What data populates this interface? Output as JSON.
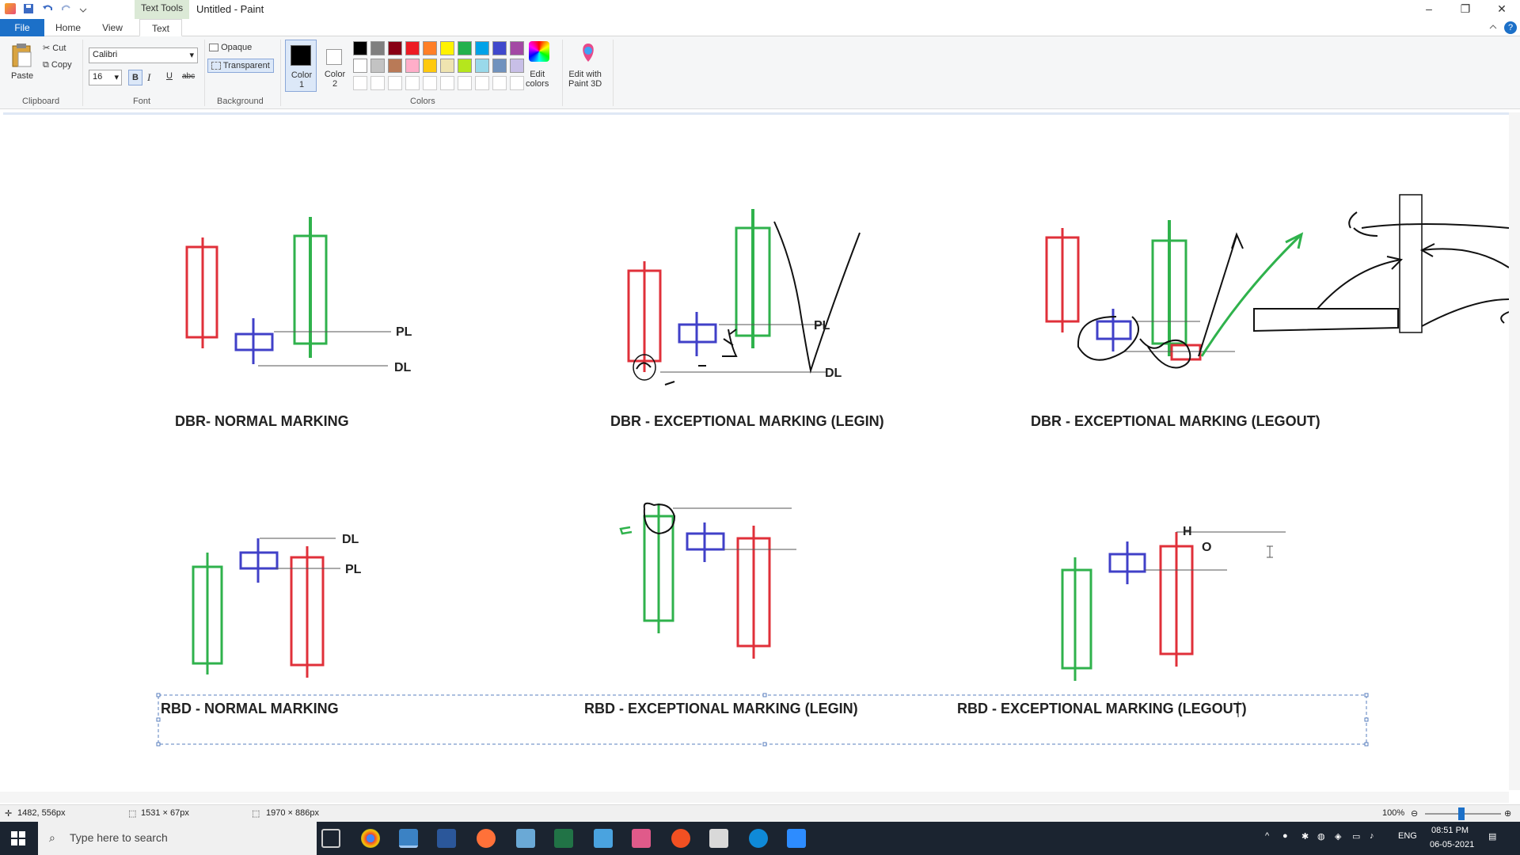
{
  "window": {
    "contextual_tab": "Text Tools",
    "title": "Untitled - Paint",
    "minimize": "–",
    "restore": "❐",
    "close": "✕"
  },
  "tabs": {
    "file": "File",
    "home": "Home",
    "view": "View",
    "text": "Text"
  },
  "ribbon": {
    "clipboard": {
      "paste": "Paste",
      "cut": "Cut",
      "copy": "Copy",
      "label": "Clipboard"
    },
    "font": {
      "family": "Calibri",
      "size": "16",
      "bold": "B",
      "italic": "I",
      "underline": "U",
      "strikethrough": "abc",
      "label": "Font"
    },
    "background": {
      "opaque": "Opaque",
      "transparent": "Transparent",
      "label": "Background"
    },
    "colors": {
      "color1_line1": "Color",
      "color1_line2": "1",
      "color2_line1": "Color",
      "color2_line2": "2",
      "edit_colors_line1": "Edit",
      "edit_colors_line2": "colors",
      "paint3d_line1": "Edit with",
      "paint3d_line2": "Paint 3D",
      "label": "Colors",
      "palette_row1": [
        "#000000",
        "#7f7f7f",
        "#880015",
        "#ed1c24",
        "#ff7f27",
        "#fff200",
        "#22b14c",
        "#00a2e8",
        "#3f48cc",
        "#a349a4"
      ],
      "palette_row2": [
        "#ffffff",
        "#c3c3c3",
        "#b97a57",
        "#ffaec9",
        "#ffc90e",
        "#efe4b0",
        "#b5e61d",
        "#99d9ea",
        "#7092be",
        "#c8bfe7"
      ]
    }
  },
  "canvas": {
    "labels": {
      "dbr_normal": "DBR- NORMAL MARKING",
      "dbr_legin": "DBR - EXCEPTIONAL MARKING (LEGIN)",
      "dbr_legout": "DBR - EXCEPTIONAL MARKING (LEGOUT)",
      "rbd_normal": "RBD - NORMAL MARKING",
      "rbd_legin": "RBD - EXCEPTIONAL MARKING (LEGIN)",
      "rbd_legout": "RBD - EXCEPTIONAL MARKING (LEGOUT)"
    },
    "annotations": {
      "pl": "PL",
      "dl": "DL",
      "h": "H",
      "o": "O"
    }
  },
  "status": {
    "cursor_pos": "1482, 556px",
    "selection_size": "1531 × 67px",
    "image_size": "1970 × 886px",
    "zoom": "100%"
  },
  "taskbar": {
    "search_placeholder": "Type here to search",
    "lang": "ENG",
    "time": "08:51 PM",
    "date": "06-05-2021"
  },
  "colors": {
    "accent": "#1c70c8",
    "candle_red": "#e0303a",
    "candle_green": "#2fb24c",
    "candle_blue": "#4040c8"
  }
}
